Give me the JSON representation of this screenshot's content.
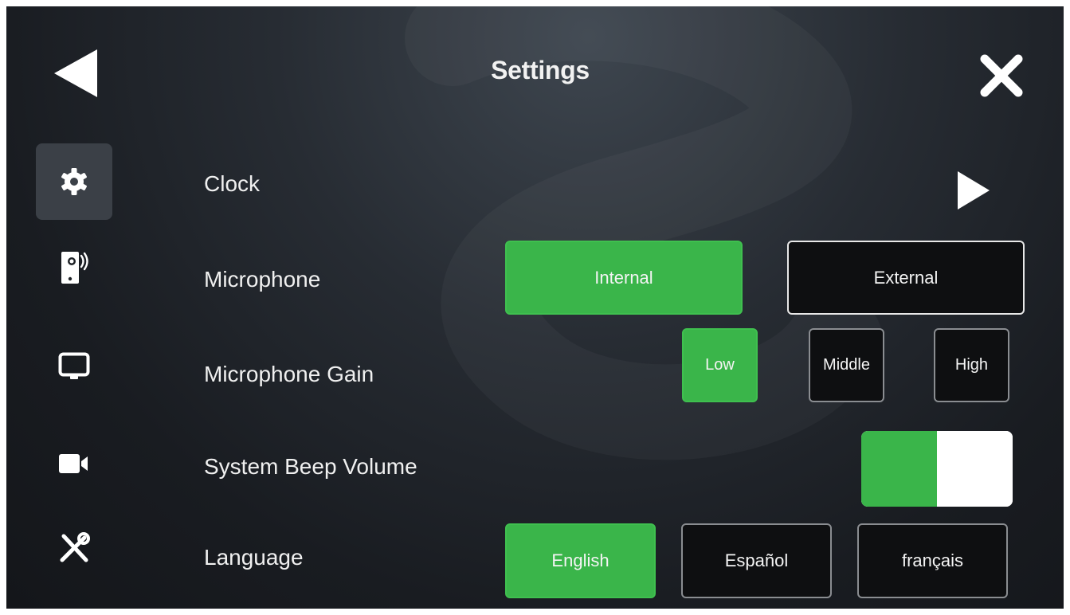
{
  "header": {
    "title": "Settings",
    "back_icon": "back-triangle-icon",
    "close_icon": "close-x-icon"
  },
  "sidebar": {
    "items": [
      {
        "id": "general",
        "icon": "gear-icon",
        "active": true
      },
      {
        "id": "door-phone",
        "icon": "door-phone-icon",
        "active": false
      },
      {
        "id": "display",
        "icon": "monitor-icon",
        "active": false
      },
      {
        "id": "camera",
        "icon": "video-camera-icon",
        "active": false
      },
      {
        "id": "tools",
        "icon": "tools-icon",
        "active": false
      }
    ]
  },
  "settings": {
    "clock": {
      "label": "Clock",
      "icon": "chevron-right-icon"
    },
    "microphone": {
      "label": "Microphone",
      "options": [
        "Internal",
        "External"
      ],
      "selected": "Internal"
    },
    "microphone_gain": {
      "label": "Microphone Gain",
      "options": [
        "Low",
        "Middle",
        "High"
      ],
      "selected": "Low"
    },
    "system_beep_volume": {
      "label": "System Beep Volume",
      "level": 0.5
    },
    "language": {
      "label": "Language",
      "options": [
        "English",
        "Español",
        "français"
      ],
      "selected": "English"
    }
  },
  "colors": {
    "accent": "#3ab54a",
    "background": "#1e2227",
    "text": "#f0f0f0"
  }
}
